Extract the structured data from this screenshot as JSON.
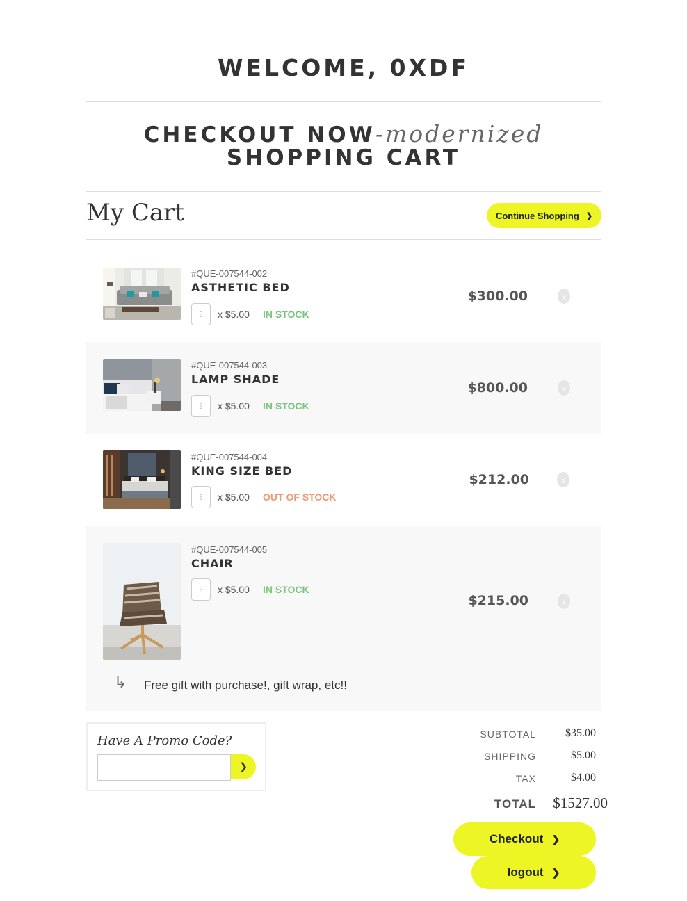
{
  "header": {
    "welcome": "WELCOME, 0XDF",
    "title_main": "CHECKOUT NOW",
    "title_sub": "-modernized",
    "title_line2": "SHOPPING CART"
  },
  "cart": {
    "title": "My Cart",
    "continue_label": "Continue Shopping",
    "items": [
      {
        "sku": "#QUE-007544-002",
        "name": "ASTHETIC BED",
        "qty": "⋮",
        "unit_price": "x $5.00",
        "stock": "IN STOCK",
        "price": "$300.00",
        "remove": "x"
      },
      {
        "sku": "#QUE-007544-003",
        "name": "LAMP SHADE",
        "qty": "⋮",
        "unit_price": "x $5.00",
        "stock": "IN STOCK",
        "price": "$800.00",
        "remove": "x"
      },
      {
        "sku": "#QUE-007544-004",
        "name": "KING SIZE BED",
        "qty": "⋮",
        "unit_price": "x $5.00",
        "stock": "OUT OF STOCK",
        "price": "$212.00",
        "remove": "x"
      },
      {
        "sku": "#QUE-007544-005",
        "name": "CHAIR",
        "qty": "⋮",
        "unit_price": "x $5.00",
        "stock": "IN STOCK",
        "price": "$215.00",
        "remove": "x"
      }
    ],
    "gift_arrow": "↳",
    "gift_note": "Free gift with purchase!, gift wrap, etc!!"
  },
  "promo": {
    "title": "Have A Promo Code?",
    "input_value": "",
    "submit_icon": "❯"
  },
  "summary": {
    "subtotal_label": "SUBTOTAL",
    "subtotal": "$35.00",
    "shipping_label": "SHIPPING",
    "shipping": "$5.00",
    "tax_label": "TAX",
    "tax": "$4.00",
    "total_label": "TOTAL",
    "total": "$1527.00"
  },
  "actions": {
    "checkout_label": "Checkout",
    "logout_label": "logout",
    "chevron": "❯"
  },
  "colors": {
    "accent": "#eef524",
    "in_stock": "#7ac47f",
    "out_of_stock": "#ec9b76",
    "shaded_row": "#f8f8f8"
  }
}
